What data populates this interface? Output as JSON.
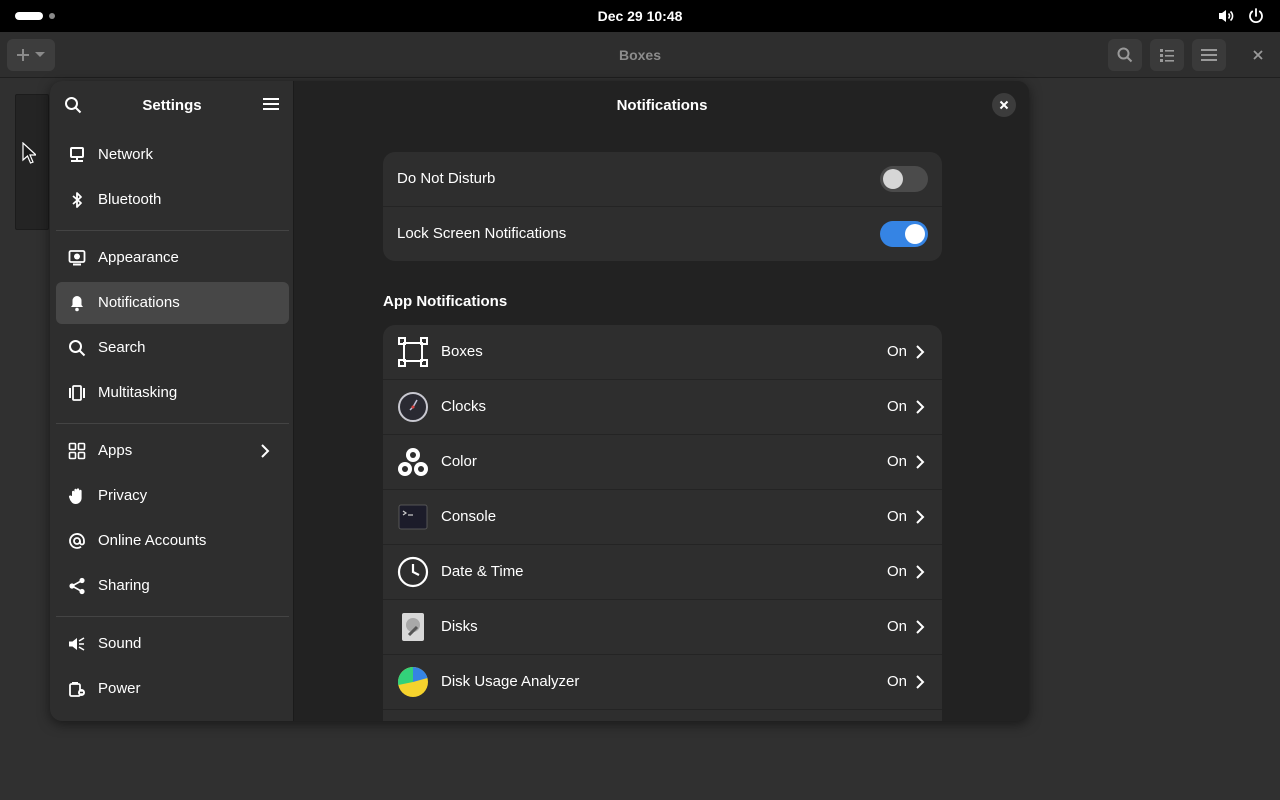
{
  "topbar": {
    "clock": "Dec 29  10:48"
  },
  "boxes": {
    "title": "Boxes"
  },
  "settings": {
    "sidebar_title": "Settings",
    "nav": [
      {
        "label": "Network",
        "icon": "network-icon"
      },
      {
        "label": "Bluetooth",
        "icon": "bluetooth-icon"
      },
      {
        "label": "Appearance",
        "icon": "appearance-icon"
      },
      {
        "label": "Notifications",
        "icon": "bell-icon",
        "active": true
      },
      {
        "label": "Search",
        "icon": "search-icon"
      },
      {
        "label": "Multitasking",
        "icon": "multitasking-icon"
      },
      {
        "label": "Apps",
        "icon": "apps-grid-icon",
        "has_submenu": true
      },
      {
        "label": "Privacy",
        "icon": "hand-icon"
      },
      {
        "label": "Online Accounts",
        "icon": "at-sign-icon"
      },
      {
        "label": "Sharing",
        "icon": "share-icon"
      },
      {
        "label": "Sound",
        "icon": "speaker-icon"
      },
      {
        "label": "Power",
        "icon": "power-icon"
      }
    ],
    "content_title": "Notifications",
    "general": [
      {
        "label": "Do Not Disturb",
        "enabled": false
      },
      {
        "label": "Lock Screen Notifications",
        "enabled": true
      }
    ],
    "app_section_title": "App Notifications",
    "apps": [
      {
        "name": "Boxes",
        "state": "On",
        "icon": "boxes-app-icon"
      },
      {
        "name": "Clocks",
        "state": "On",
        "icon": "clocks-app-icon"
      },
      {
        "name": "Color",
        "state": "On",
        "icon": "color-app-icon"
      },
      {
        "name": "Console",
        "state": "On",
        "icon": "console-app-icon"
      },
      {
        "name": "Date & Time",
        "state": "On",
        "icon": "date-time-app-icon"
      },
      {
        "name": "Disks",
        "state": "On",
        "icon": "disks-app-icon"
      },
      {
        "name": "Disk Usage Analyzer",
        "state": "On",
        "icon": "disk-usage-app-icon"
      }
    ],
    "accent": "#3584e4"
  }
}
